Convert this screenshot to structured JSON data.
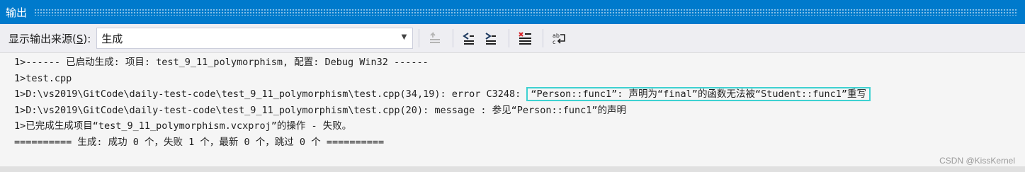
{
  "panel": {
    "title": "输出"
  },
  "toolbar": {
    "source_label_prefix": "显示输出来源(",
    "source_label_key": "S",
    "source_label_suffix": "):",
    "source_value": "生成"
  },
  "output_lines": [
    "1>------ 已启动生成: 项目: test_9_11_polymorphism, 配置: Debug Win32 ------",
    "1>test.cpp",
    "1>D:\\vs2019\\GitCode\\daily-test-code\\test_9_11_polymorphism\\test.cpp(34,19): error C3248: ",
    "“Person::func1”: 声明为“final”的函数无法被“Student::func1”重写",
    "1>D:\\vs2019\\GitCode\\daily-test-code\\test_9_11_polymorphism\\test.cpp(20): message : 参见“Person::func1”的声明",
    "1>已完成生成项目“test_9_11_polymorphism.vcxproj”的操作 - 失败。",
    "========== 生成: 成功 0 个，失败 1 个，最新 0 个，跳过 0 个 =========="
  ],
  "watermark": "CSDN @KissKernel"
}
